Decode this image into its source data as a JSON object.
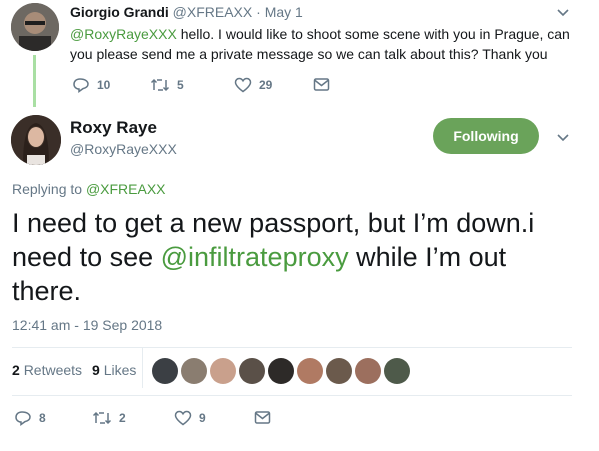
{
  "reply_tweet": {
    "name": "Giorgio Grandi",
    "handle": "@XFREAXX",
    "date": "May 1",
    "mention": "@RoxyRayeXXX",
    "text": " hello. I would like to shoot some scene with you in Prague, can you please send me a private message so we can talk about this? Thank you",
    "replies": "10",
    "retweets": "5",
    "likes": "29"
  },
  "main_tweet": {
    "name": "Roxy Raye",
    "handle": "@RoxyRayeXXX",
    "follow_label": "Following",
    "replying_prefix": "Replying to",
    "replying_to": "@XFREAXX",
    "text_before": "I need to get a new passport, but I’m down.i need to see ",
    "text_mention": "@infiltrateproxy",
    "text_after": " while I’m out there.",
    "timestamp": "12:41 am - 19 Sep 2018",
    "retweet_count": "2",
    "retweet_label": "Retweets",
    "like_count": "9",
    "like_label": "Likes",
    "replies": "8",
    "retweets": "2",
    "likes": "9"
  },
  "likers": [
    "#3b3f44",
    "#8a7d70",
    "#c9a08c",
    "#5a5048",
    "#2d2a28",
    "#b07a63",
    "#6b5a4c",
    "#9c6f5e",
    "#4e5a4a"
  ],
  "colors": {
    "accent": "#6aa35a",
    "mention": "#4a9b3f",
    "muted": "#657786"
  }
}
